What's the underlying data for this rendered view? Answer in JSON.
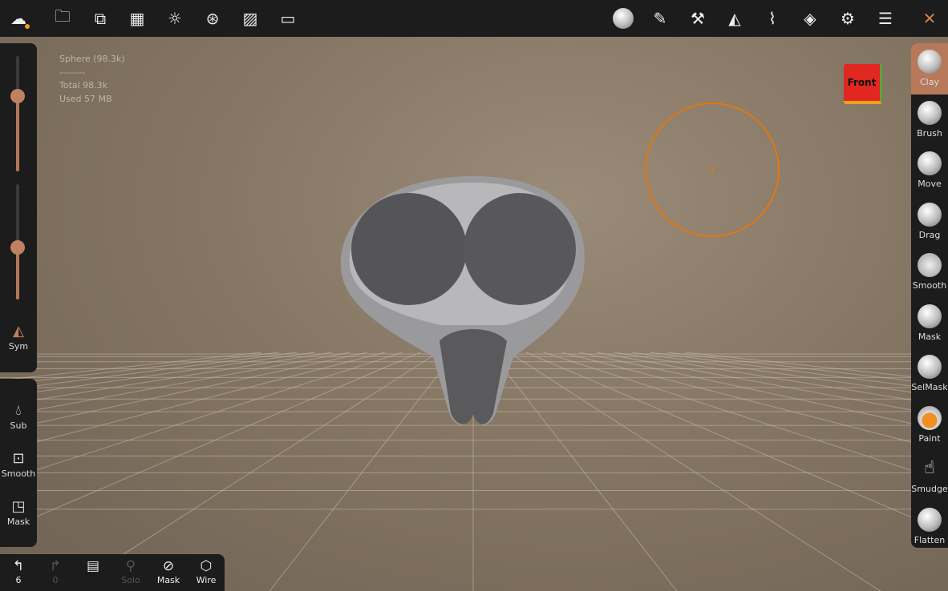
{
  "topbar": {
    "left_icons": [
      "nomad-logo-icon",
      "folder-icon",
      "scene-tree-icon",
      "grid-icon",
      "light-icon",
      "camera-aperture-icon",
      "image-icon",
      "video-icon"
    ],
    "right_icons": [
      "material-sphere-icon",
      "brush-icon",
      "hammer-icon",
      "symmetry-icon",
      "topology-icon",
      "layers-icon",
      "settings-icon",
      "sliders-icon",
      "tools-icon"
    ],
    "accent": "#f0a020"
  },
  "stats": {
    "mesh": "Sphere (98.3k)",
    "separator": "--------",
    "total": "Total 98.3k",
    "used": "Used 57 MB"
  },
  "left_panel": {
    "radius_slider": 0.65,
    "intensity_slider": 0.45,
    "sym_label": "Sym",
    "sub_label": "Sub",
    "smooth_label": "Smooth",
    "mask_label": "Mask"
  },
  "bottombar": {
    "undo_count": "6",
    "redo_count": "0",
    "solo_label": "Solo",
    "mask_label": "Mask",
    "wire_label": "Wire"
  },
  "tools": [
    "Clay",
    "Brush",
    "Move",
    "Drag",
    "Smooth",
    "Mask",
    "SelMask",
    "Paint",
    "Smudge",
    "Flatten"
  ],
  "active_tool": "Clay",
  "view_cube": "Front",
  "brush_color": "#e07810"
}
